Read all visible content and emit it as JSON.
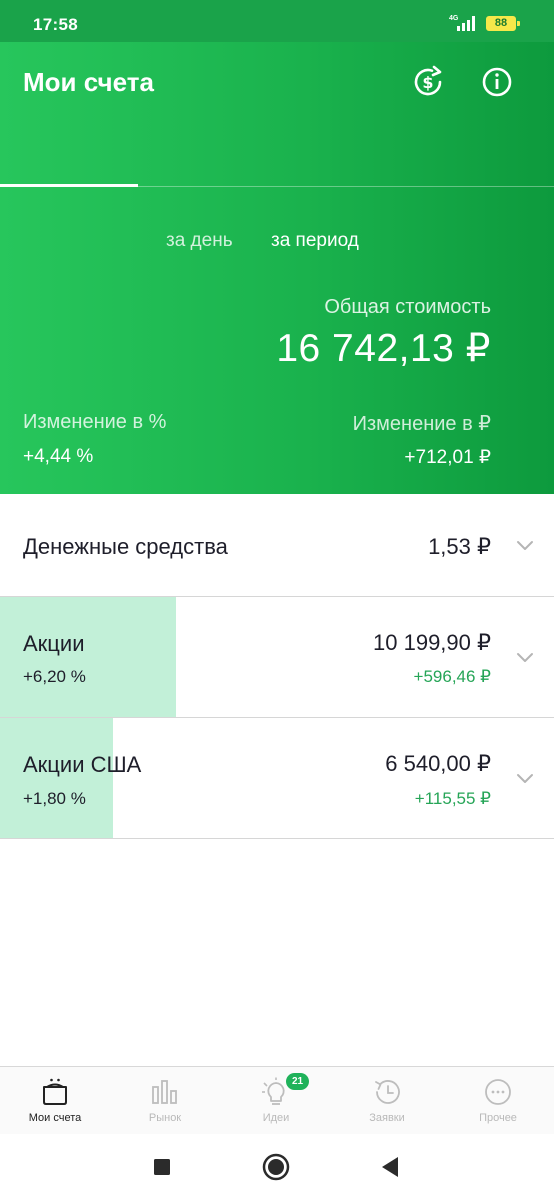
{
  "status_bar": {
    "time": "17:58",
    "network": "4G",
    "battery": "88",
    "accent_color": "#f6e84a"
  },
  "header": {
    "title": "Мои счета",
    "icons": [
      "currency-exchange-icon",
      "info-icon"
    ],
    "periods": {
      "day": "за день",
      "period": "за период",
      "selected": "period"
    },
    "total_label": "Общая стоимость",
    "total_value": "16 742,13 ₽",
    "change_pct_label": "Изменение в  %",
    "change_pct_value": "+4,44  %",
    "change_rub_label": "Изменение в ₽",
    "change_rub_value": "+712,01 ₽",
    "brand_color": "#1ab24d"
  },
  "holdings": [
    {
      "name": "Денежные средства",
      "amount": "1,53 ₽"
    },
    {
      "name": "Акции",
      "pct": "+6,20  %",
      "amount": "10 199,90 ₽",
      "delta": "+596,46 ₽",
      "share_fill": 0.32
    },
    {
      "name": "Акции США",
      "pct": "+1,80  %",
      "amount": "6 540,00 ₽",
      "delta": "+115,55 ₽",
      "share_fill": 0.2
    }
  ],
  "bottom_nav": [
    {
      "label": "Мои счета",
      "icon": "wallet-icon",
      "active": true
    },
    {
      "label": "Рынок",
      "icon": "bar-chart-icon",
      "active": false
    },
    {
      "label": "Идеи",
      "icon": "lightbulb-icon",
      "active": false,
      "badge": "21"
    },
    {
      "label": "Заявки",
      "icon": "history-icon",
      "active": false
    },
    {
      "label": "Прочее",
      "icon": "more-icon",
      "active": false
    }
  ],
  "system_nav": [
    "recents-button",
    "home-button",
    "back-button"
  ],
  "colors": {
    "positive": "#26a557",
    "fill": "#c2f0d8"
  }
}
